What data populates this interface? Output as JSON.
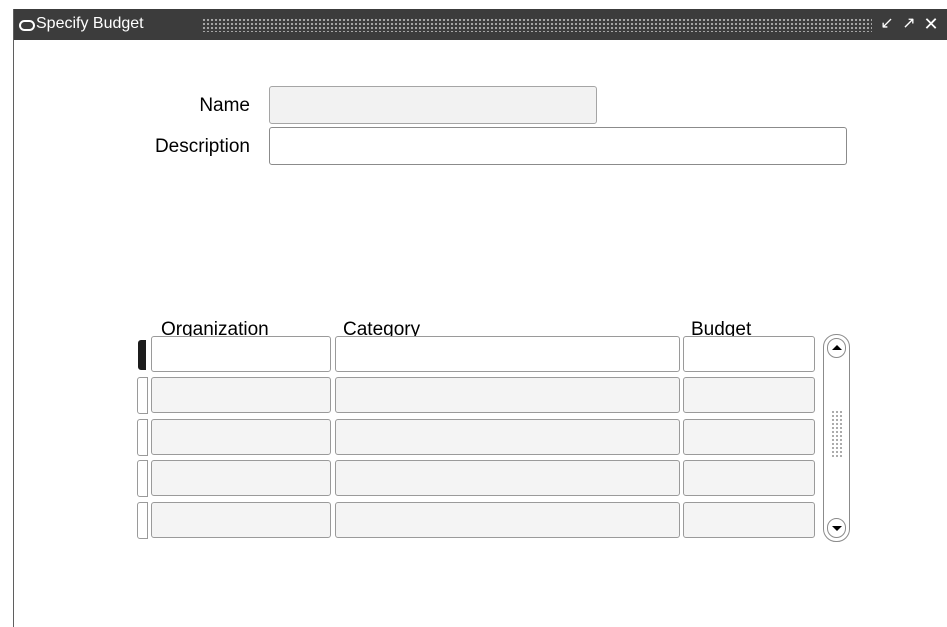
{
  "window": {
    "title": "Specify Budget",
    "icon": "window-menu-icon",
    "controls": {
      "minimize": "↙",
      "maximize": "↗",
      "close": "✕"
    }
  },
  "form": {
    "name": {
      "label": "Name",
      "value": ""
    },
    "description": {
      "label": "Description",
      "value": ""
    }
  },
  "table": {
    "columns": [
      "Organization",
      "Category",
      "Budget"
    ],
    "rows": [
      {
        "organization": "",
        "category": "",
        "budget": ""
      },
      {
        "organization": "",
        "category": "",
        "budget": ""
      },
      {
        "organization": "",
        "category": "",
        "budget": ""
      },
      {
        "organization": "",
        "category": "",
        "budget": ""
      },
      {
        "organization": "",
        "category": "",
        "budget": ""
      }
    ]
  },
  "colors": {
    "titlebar": "#3c3c3c",
    "active_row_marker": "#1c1c1c",
    "readonly_field": "#f2f2f2"
  }
}
